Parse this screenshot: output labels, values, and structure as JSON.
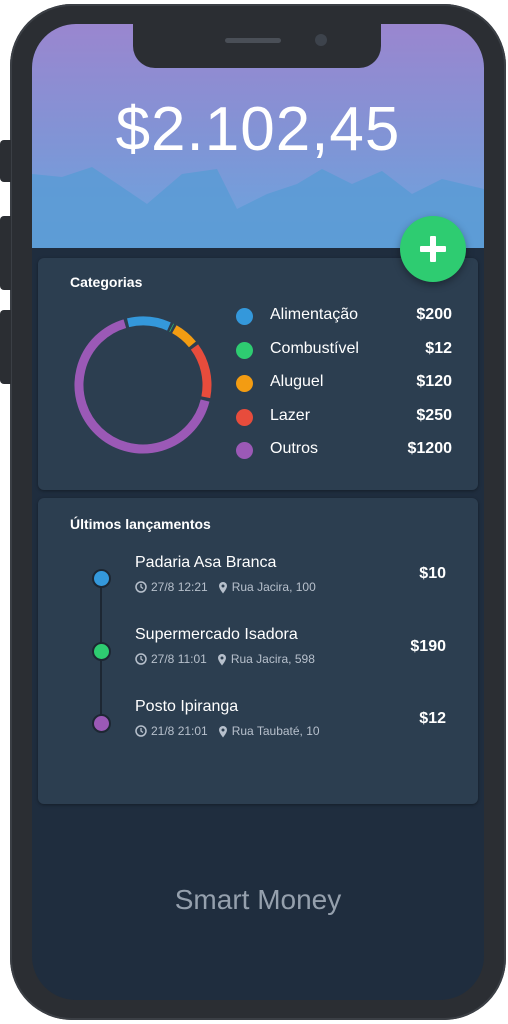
{
  "balance": "$2.102,45",
  "add_button_icon": "plus-icon",
  "categories_card": {
    "title": "Categorias",
    "items": [
      {
        "label": "Alimentação",
        "value": "$200",
        "color": "#3498db"
      },
      {
        "label": "Combustível",
        "value": "$12",
        "color": "#2ecc71"
      },
      {
        "label": "Aluguel",
        "value": "$120",
        "color": "#f39c12"
      },
      {
        "label": "Lazer",
        "value": "$250",
        "color": "#e74c3c"
      },
      {
        "label": "Outros",
        "value": "$1200",
        "color": "#9b59b6"
      }
    ]
  },
  "chart_data": {
    "type": "pie",
    "categories": [
      "Alimentação",
      "Combustível",
      "Aluguel",
      "Lazer",
      "Outros"
    ],
    "values": [
      200,
      12,
      120,
      250,
      1200
    ],
    "colors": [
      "#3498db",
      "#2ecc71",
      "#f39c12",
      "#e74c3c",
      "#9b59b6"
    ],
    "donut": true
  },
  "transactions_card": {
    "title": "Últimos lançamentos",
    "items": [
      {
        "title": "Padaria Asa Branca",
        "datetime": "27/8 12:21",
        "location": "Rua Jacira, 100",
        "amount": "$10",
        "color": "#3498db"
      },
      {
        "title": "Supermercado Isadora",
        "datetime": "27/8 11:01",
        "location": "Rua Jacira, 598",
        "amount": "$190",
        "color": "#2ecc71"
      },
      {
        "title": "Posto Ipiranga",
        "datetime": "21/8 21:01",
        "location": "Rua Taubaté, 10",
        "amount": "$12",
        "color": "#9b59b6"
      }
    ]
  },
  "footer": {
    "app_name": "Smart Money"
  }
}
